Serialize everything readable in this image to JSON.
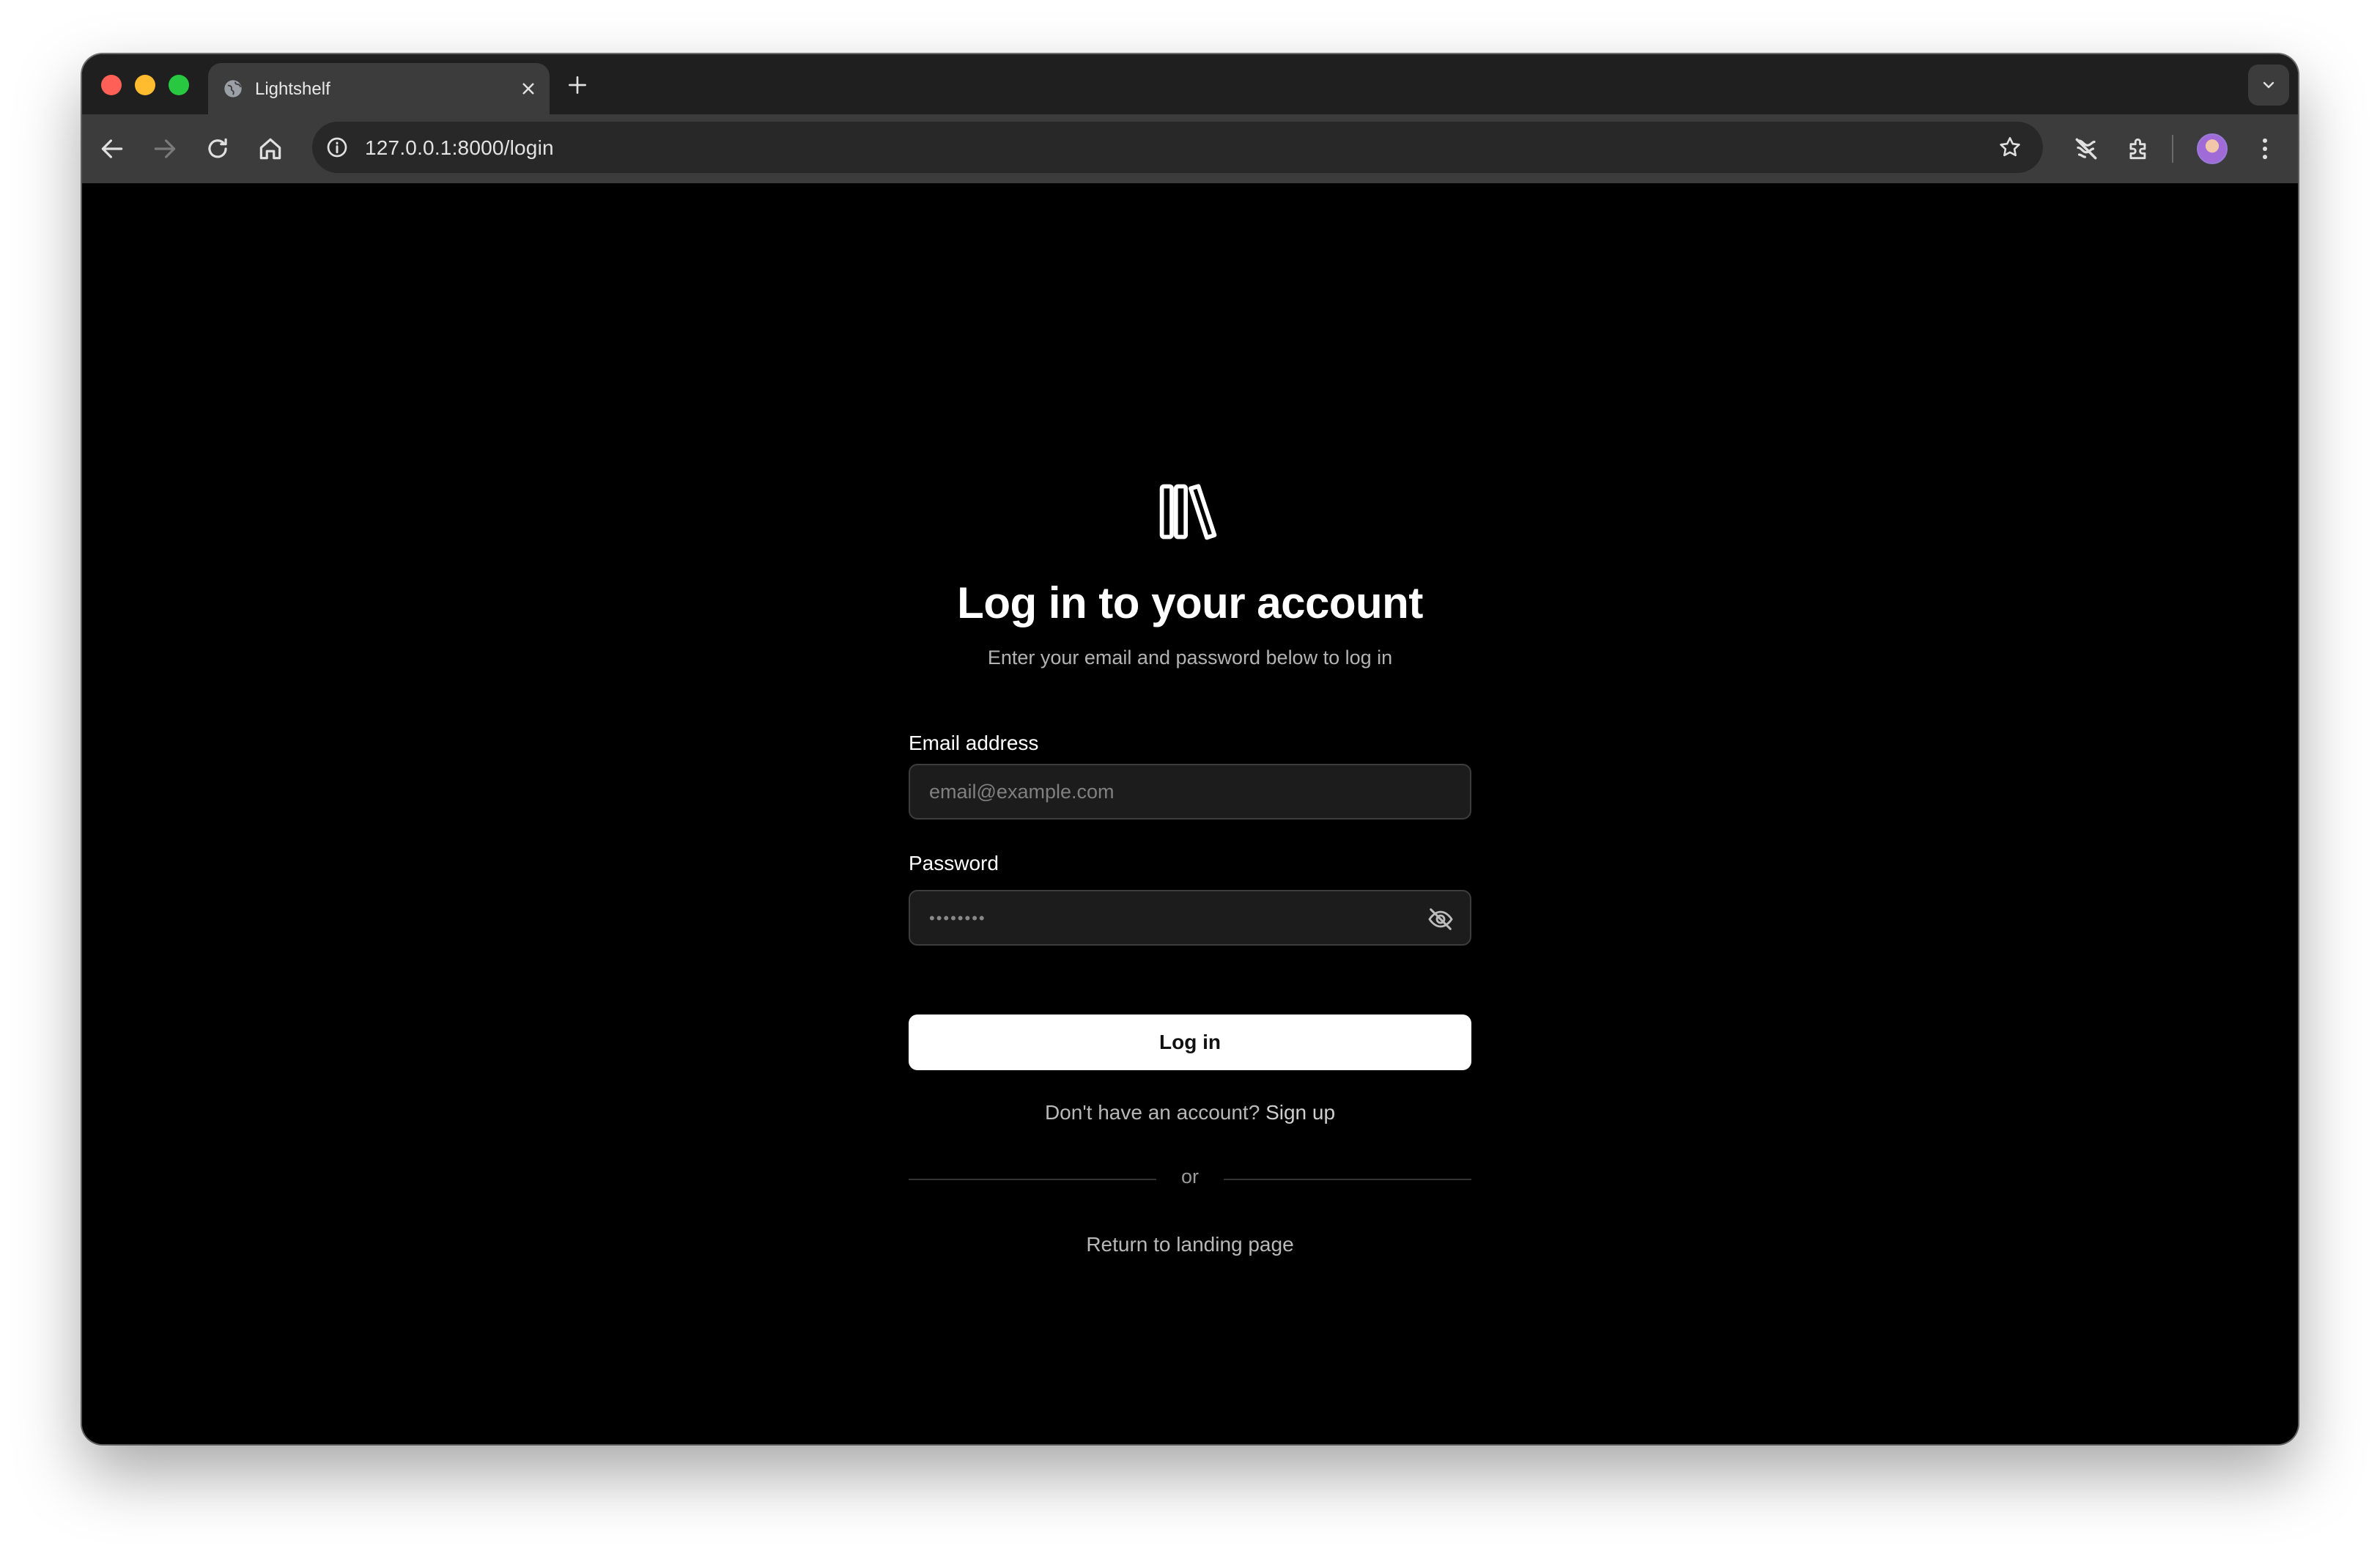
{
  "browser": {
    "tab_title": "Lightshelf",
    "url": "127.0.0.1:8000/login"
  },
  "login": {
    "title": "Log in to your account",
    "subtitle": "Enter your email and password below to log in",
    "email_label": "Email address",
    "email_placeholder": "email@example.com",
    "email_value": "",
    "password_label": "Password",
    "password_dots": "••••••••",
    "submit_label": "Log in",
    "signup_prompt": "Don't have an account?",
    "signup_link": "Sign up",
    "divider_text": "or",
    "return_link": "Return to landing page"
  },
  "colors": {
    "page_background": "#000000",
    "button_background": "#ffffff",
    "input_background": "#1c1c1c"
  }
}
